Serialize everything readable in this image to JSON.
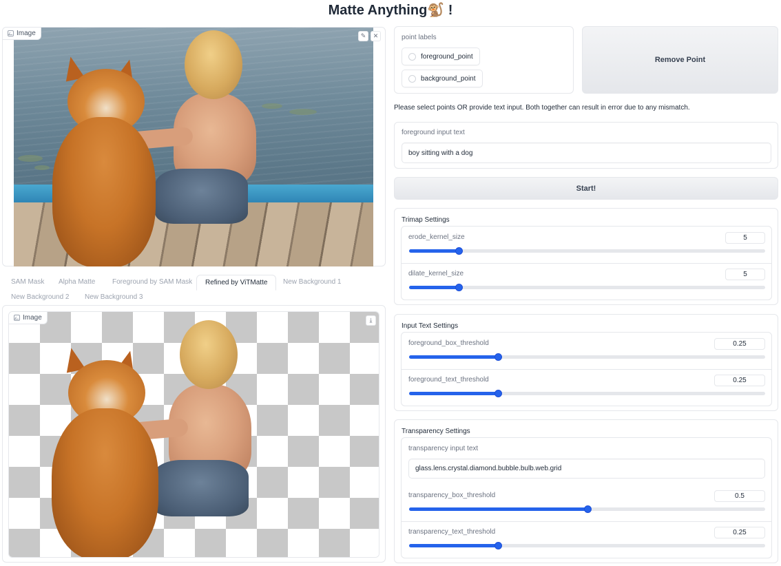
{
  "app": {
    "title": "Matte Anything🐒 !"
  },
  "input_image": {
    "label": "Image"
  },
  "tabs": [
    {
      "label": "SAM Mask",
      "active": false
    },
    {
      "label": "Alpha Matte",
      "active": false
    },
    {
      "label": "Foreground by SAM Mask",
      "active": false
    },
    {
      "label": "Refined by ViTMatte",
      "active": true
    },
    {
      "label": "New Background 1",
      "active": false
    },
    {
      "label": "New Background 2",
      "active": false
    },
    {
      "label": "New Background 3",
      "active": false
    }
  ],
  "output_image": {
    "label": "Image"
  },
  "point_labels": {
    "label": "point labels",
    "options": [
      "foreground_point",
      "background_point"
    ]
  },
  "remove_point_button": "Remove Point",
  "note": "Please select points OR provide text input. Both together can result in error due to any mismatch.",
  "foreground_input": {
    "label": "foreground input text",
    "value": "boy sitting with a dog"
  },
  "start_button": "Start!",
  "trimap_settings": {
    "title": "Trimap Settings",
    "sliders": [
      {
        "label": "erode_kernel_size",
        "value": "5",
        "fraction": 0.14
      },
      {
        "label": "dilate_kernel_size",
        "value": "5",
        "fraction": 0.14
      }
    ]
  },
  "input_text_settings": {
    "title": "Input Text Settings",
    "sliders": [
      {
        "label": "foreground_box_threshold",
        "value": "0.25",
        "fraction": 0.25
      },
      {
        "label": "foreground_text_threshold",
        "value": "0.25",
        "fraction": 0.25
      }
    ]
  },
  "transparency_settings": {
    "title": "Transparency Settings",
    "input": {
      "label": "transparency input text",
      "value": "glass.lens.crystal.diamond.bubble.bulb.web.grid"
    },
    "sliders": [
      {
        "label": "transparency_box_threshold",
        "value": "0.5",
        "fraction": 0.5
      },
      {
        "label": "transparency_text_threshold",
        "value": "0.25",
        "fraction": 0.25
      }
    ]
  },
  "colors": {
    "accent": "#2563eb",
    "border": "#e5e7eb"
  },
  "icons": [
    "image-icon",
    "edit-icon",
    "close-icon",
    "download-icon"
  ]
}
